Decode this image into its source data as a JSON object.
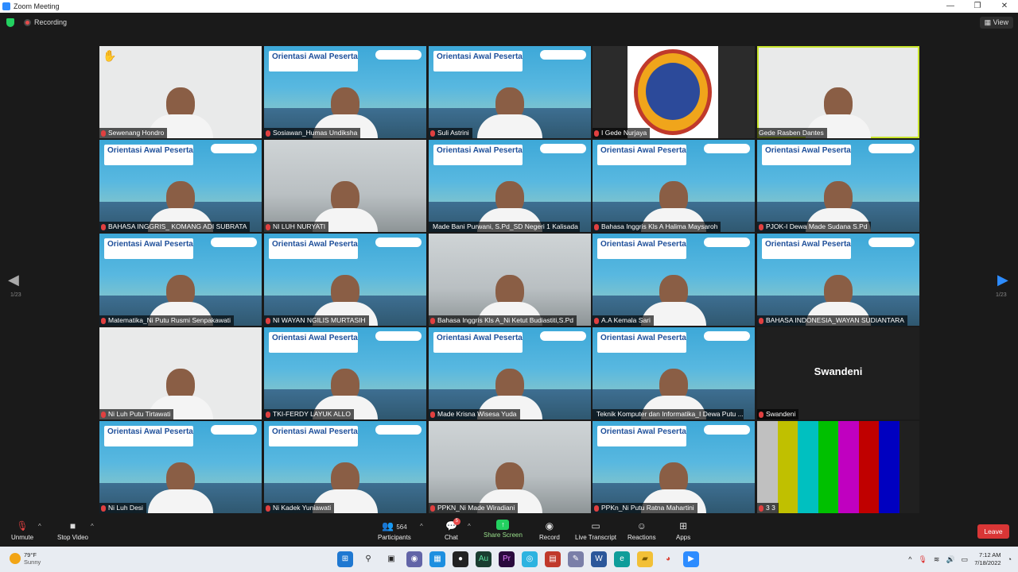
{
  "window": {
    "title": "Zoom Meeting",
    "buttons": [
      "—",
      "❐",
      "✕"
    ]
  },
  "topbar": {
    "recording_label": "Recording",
    "view_label": "View"
  },
  "pagination": {
    "left": "1/23",
    "right": "1/23"
  },
  "slide": {
    "title": "Orientasi Awal Peserta"
  },
  "participants_tiles": [
    {
      "name": "Sewenang Hondro",
      "bg": "white",
      "muted": true,
      "hand": true
    },
    {
      "name": "Sosiawan_Humas Undiksha",
      "bg": "slide",
      "muted": true
    },
    {
      "name": "Suli Astrini",
      "bg": "slide",
      "muted": true
    },
    {
      "name": "I Gede Nurjaya",
      "bg": "logo",
      "muted": true
    },
    {
      "name": "Gede Rasben Dantes",
      "bg": "white",
      "muted": false,
      "speaker": true
    },
    {
      "name": "BAHASA INGGRIS_ KOMANG ADI SUBRATA",
      "bg": "slide",
      "muted": true
    },
    {
      "name": "NI LUH NURYATI",
      "bg": "room",
      "muted": true
    },
    {
      "name": "Made Bani Purwani, S.Pd_SD Negeri 1 Kalisada",
      "bg": "slide",
      "muted": true
    },
    {
      "name": "Bahasa Inggris Kls A Halima Maysaroh",
      "bg": "slide",
      "muted": true
    },
    {
      "name": "PJOK-I Dewa Made Sudana S.Pd",
      "bg": "slide",
      "muted": true
    },
    {
      "name": "Matematika_Ni Putu Rusmi Senpakawati",
      "bg": "slide",
      "muted": true
    },
    {
      "name": "NI WAYAN NGILIS MURTASIH",
      "bg": "slide",
      "muted": true
    },
    {
      "name": "Bahasa Inggris Kls A_Ni Ketut Budiastiti,S.Pd",
      "bg": "room",
      "muted": true
    },
    {
      "name": "A.A Kemala Sari",
      "bg": "slide",
      "muted": true
    },
    {
      "name": "BAHASA INDONESIA_WAYAN SUDIANTARA",
      "bg": "slide",
      "muted": true
    },
    {
      "name": "Ni Luh Putu Tirtawati",
      "bg": "white",
      "muted": true
    },
    {
      "name": "TKI-FERDY LAYUK ALLO",
      "bg": "slide",
      "muted": true
    },
    {
      "name": "Made Krisna Wisesa Yuda",
      "bg": "slide",
      "muted": true
    },
    {
      "name": "Teknik Komputer dan Informatika_I Dewa Putu ...",
      "bg": "slide",
      "muted": true
    },
    {
      "name": "Swandeni",
      "bg": "dark",
      "muted": true,
      "center_name": "Swandeni"
    },
    {
      "name": "Ni Luh Desi",
      "bg": "slide",
      "muted": true
    },
    {
      "name": "Ni Kadek Yuniawati",
      "bg": "slide",
      "muted": true
    },
    {
      "name": "PPKN_Ni Made Wiradiani",
      "bg": "room",
      "muted": true
    },
    {
      "name": "PPKn_Ni Putu Ratna Mahartini",
      "bg": "slide",
      "muted": true
    },
    {
      "name": "3 3",
      "bg": "bars",
      "muted": true
    }
  ],
  "toolbar": {
    "unmute": "Unmute",
    "stop_video": "Stop Video",
    "participants_count": "564",
    "participants": "Participants",
    "chat": "Chat",
    "chat_badge": "5",
    "share_screen": "Share Screen",
    "record": "Record",
    "live_transcript": "Live Transcript",
    "reactions": "Reactions",
    "apps": "Apps",
    "leave": "Leave"
  },
  "taskbar": {
    "temp": "79°F",
    "weather": "Sunny",
    "time": "7:12 AM",
    "date": "7/18/2022"
  },
  "colors": {
    "accent": "#2d8cff",
    "speaker_border": "#c9e52c",
    "leave": "#d93636",
    "share": "#23d160"
  }
}
